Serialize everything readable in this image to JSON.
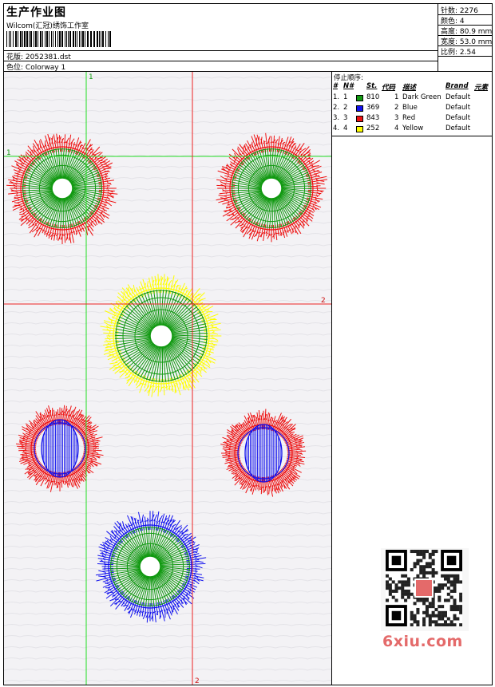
{
  "header": {
    "title": "生产作业图",
    "studio": "Wilcom(汇冠)绣饰工作室",
    "design_label": "花版:",
    "design_value": "2052381.dst",
    "colorway_label": "色位:",
    "colorway_value": "Colorway 1"
  },
  "stats": {
    "stitches": "针数: 2276",
    "colors": "颜色: 4",
    "height": "高度: 80.9 mm",
    "width": "宽度: 53.0 mm",
    "scale": "比例: 2.54"
  },
  "design": {
    "guides": {
      "green_v_label": "1",
      "green_h_label": "1",
      "red_h_label": "2",
      "red_v_label": "2"
    },
    "colors": {
      "background": "#f3f2f5",
      "green_guide": "#22dd22",
      "red_guide": "#ee2222"
    },
    "flowers": [
      {
        "outer": "#ee1111",
        "inner": "#119911",
        "center_type": "hole"
      },
      {
        "outer": "#ee1111",
        "inner": "#119911",
        "center_type": "hole"
      },
      {
        "outer": "#ffff00",
        "inner": "#119911",
        "center_type": "hole"
      },
      {
        "outer": "#ee1111",
        "inner": "#1111ee",
        "center_type": "oval"
      },
      {
        "outer": "#ee1111",
        "inner": "#1111ee",
        "center_type": "oval"
      },
      {
        "outer": "#1111ee",
        "inner": "#119911",
        "center_type": "hole"
      }
    ]
  },
  "stop_sequence": {
    "title": "停止顺序:",
    "headers": {
      "idx": "#",
      "no": "N#",
      "st": "St.",
      "code": "代码",
      "desc": "描述",
      "brand": "Brand",
      "element": "元素"
    },
    "rows": [
      {
        "idx": "1.",
        "no": "1",
        "st": "810",
        "code": "1",
        "desc": "Dark Green",
        "brand": "Default",
        "color": "#119911"
      },
      {
        "idx": "2.",
        "no": "2",
        "st": "369",
        "code": "2",
        "desc": "Blue",
        "brand": "Default",
        "color": "#1111ee"
      },
      {
        "idx": "3.",
        "no": "3",
        "st": "843",
        "code": "3",
        "desc": "Red",
        "brand": "Default",
        "color": "#ee1111"
      },
      {
        "idx": "4.",
        "no": "4",
        "st": "252",
        "code": "4",
        "desc": "Yellow",
        "brand": "Default",
        "color": "#ffff00"
      }
    ]
  },
  "watermark": {
    "text": "6xiu.com",
    "color": "#e46a6a"
  }
}
